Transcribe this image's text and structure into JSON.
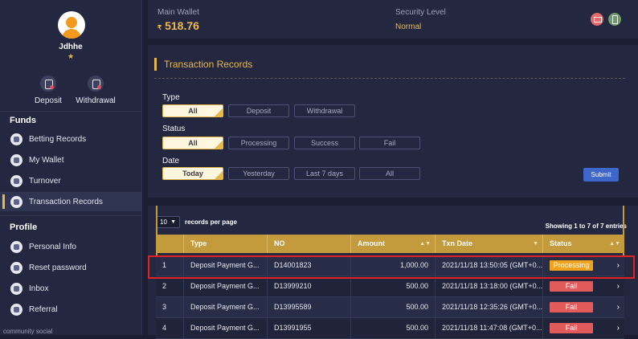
{
  "user": {
    "name": "Jdhhe",
    "star": "★"
  },
  "quick_actions": [
    {
      "label": "Deposit",
      "icon": "deposit-icon"
    },
    {
      "label": "Withdrawal",
      "icon": "withdrawal-icon"
    }
  ],
  "sidebar": {
    "funds_title": "Funds",
    "funds_items": [
      {
        "label": "Betting Records",
        "icon": "betting-records-icon"
      },
      {
        "label": "My Wallet",
        "icon": "wallet-icon"
      },
      {
        "label": "Turnover",
        "icon": "turnover-icon"
      },
      {
        "label": "Transaction Records",
        "icon": "transaction-records-icon",
        "active": true
      }
    ],
    "profile_title": "Profile",
    "profile_items": [
      {
        "label": "Personal Info",
        "icon": "personal-info-icon"
      },
      {
        "label": "Reset password",
        "icon": "lock-icon"
      },
      {
        "label": "Inbox",
        "icon": "inbox-icon"
      },
      {
        "label": "Referral",
        "icon": "referral-icon"
      }
    ],
    "bottom_text": "community social"
  },
  "wallet": {
    "main_label": "Main Wallet",
    "currency_symbol": "₹",
    "amount": "518.76",
    "security_label": "Security Level",
    "security_value": "Normal",
    "icons": [
      "mail-icon",
      "phone-icon"
    ]
  },
  "records": {
    "title": "Transaction Records",
    "type_label": "Type",
    "type_options": [
      "All",
      "Deposit",
      "Withdrawal"
    ],
    "status_label": "Status",
    "status_options": [
      "All",
      "Processing",
      "Success",
      "Fail"
    ],
    "date_label": "Date",
    "date_options": [
      "Today",
      "Yesterday",
      "Last 7 days",
      "All"
    ],
    "selected": {
      "type": "All",
      "status": "All",
      "date": "Today"
    },
    "submit_label": "Submit"
  },
  "table": {
    "records_per_page": "10",
    "records_per_page_label": "records per page",
    "showing_text": "Showing 1 to 7 of 7 entries",
    "columns": [
      "",
      "Type",
      "NO",
      "Amount",
      "Txn Date",
      "Status"
    ],
    "rows": [
      {
        "index": "1",
        "type": "Deposit Payment G...",
        "no": "D14001823",
        "amount": "1,000.00",
        "date": "2021/11/18 13:50:05 (GMT+0...",
        "status": "Processing"
      },
      {
        "index": "2",
        "type": "Deposit Payment G...",
        "no": "D13999210",
        "amount": "500.00",
        "date": "2021/11/18 13:18:00 (GMT+0...",
        "status": "Fail"
      },
      {
        "index": "3",
        "type": "Deposit Payment G...",
        "no": "D13995589",
        "amount": "500.00",
        "date": "2021/11/18 12:35:26 (GMT+0...",
        "status": "Fail"
      },
      {
        "index": "4",
        "type": "Deposit Payment G...",
        "no": "D13991955",
        "amount": "500.00",
        "date": "2021/11/18 11:47:08 (GMT+0...",
        "status": "Fail"
      }
    ]
  },
  "colors": {
    "accent_gold": "#e8b94a",
    "processing": "#f0a21d",
    "fail": "#e35a5a",
    "submit_blue": "#3e67c9",
    "highlight_outline": "#e02222"
  }
}
